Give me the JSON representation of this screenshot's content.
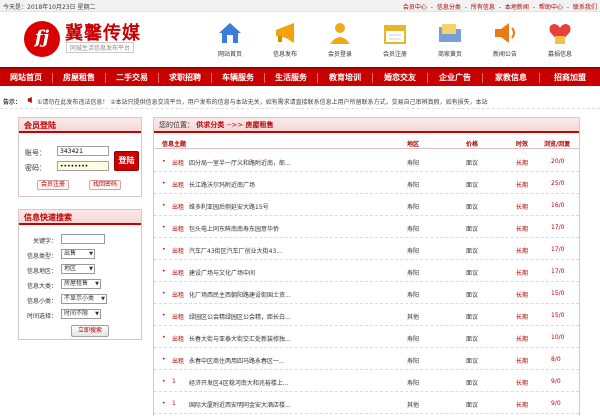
{
  "topbar": {
    "date": "今天是：2018年10月23日 星期二",
    "links": [
      "会员中心",
      "-",
      "信息分类",
      "-",
      "所有信息",
      "-",
      "本地新闻",
      "-",
      "帮助中心",
      "-",
      "联系我们"
    ]
  },
  "logo": {
    "mark": "fj",
    "title": "冀馨传媒",
    "subtitle": "同城生活信息发布平台"
  },
  "quick_links": [
    {
      "label": "网站首页",
      "icon": "house-icon",
      "color": "#3b7dd8"
    },
    {
      "label": "信息发布",
      "icon": "megaphone-icon",
      "color": "#f2a20c"
    },
    {
      "label": "会员登录",
      "icon": "person-icon",
      "color": "#f0a91a"
    },
    {
      "label": "会员注册",
      "icon": "calendar-icon",
      "color": "#e8b62c"
    },
    {
      "label": "商家黄页",
      "icon": "folder-icon",
      "color": "#7a9fd6"
    },
    {
      "label": "新闻公告",
      "icon": "speaker-icon",
      "color": "#e87a1a"
    },
    {
      "label": "募捐信息",
      "icon": "heart-icon",
      "color": "#e8403a"
    }
  ],
  "nav": {
    "items": [
      "网站首页",
      "房屋租售",
      "二手交易",
      "求职招聘",
      "车辆服务",
      "生活服务",
      "教育培训",
      "婚恋交友",
      "企业广告",
      "家教信息",
      "招商加盟"
    ]
  },
  "notice": {
    "label": "告示：",
    "text": "①请勿在此发布违法信息！ ②本站只提供信息交流平台，用户发布的信息与本站无关，如有需求请直接联系信息上用户所留联系方式，交易自己审辨真假，如有损失，本站"
  },
  "login": {
    "title": "会员登陆",
    "account_label": "账号：",
    "account_value": "343421",
    "password_label": "密码：",
    "password_value": "••••••••",
    "login_button": "登陆",
    "register_button": "会员注册",
    "forgot_button": "找回密码"
  },
  "search": {
    "title": "信息快速搜索",
    "fields": [
      {
        "label": "关键字：",
        "value": ""
      },
      {
        "label": "信息类型：",
        "value": "出售"
      },
      {
        "label": "信息地区：",
        "value": "地区"
      },
      {
        "label": "信息大类：",
        "value": "房屋租售"
      },
      {
        "label": "信息小类：",
        "value": "不显示小类"
      },
      {
        "label": "时间选择：",
        "value": "时间不限"
      }
    ],
    "submit": "立即搜索"
  },
  "list": {
    "breadcrumb_prefix": "您的位置：",
    "breadcrumb_mid": "供求分类",
    "breadcrumb_arrow": "-->>",
    "breadcrumb_current": "房屋租售",
    "columns": {
      "title": "信息主题",
      "area": "地区",
      "price": "价格",
      "time": "时效",
      "count": "浏览/回复"
    },
    "rows": [
      {
        "cat": "出租",
        "title": "四分局一室半一厅义和路附近南，郎...",
        "area": "寿阳",
        "price": "面议",
        "time": "长期",
        "count": "20/0"
      },
      {
        "cat": "出租",
        "title": "长江路沃尔玛附近南广场",
        "area": "寿阳",
        "price": "面议",
        "time": "长期",
        "count": "25/0"
      },
      {
        "cat": "出租",
        "title": "维多利亚园后侧延安大路15号",
        "area": "寿阳",
        "price": "面议",
        "time": "长期",
        "count": "16/0"
      },
      {
        "cat": "出租",
        "title": "包头电上同东眸南南寿东园意华侨",
        "area": "寿阳",
        "price": "面议",
        "time": "长期",
        "count": "17/0"
      },
      {
        "cat": "出租",
        "title": "汽车厂43街区汽车厂创业大街43...",
        "area": "寿阳",
        "price": "面议",
        "time": "长期",
        "count": "17/0"
      },
      {
        "cat": "出租",
        "title": "建设广场与文化广场中间",
        "area": "寿阳",
        "price": "面议",
        "time": "长期",
        "count": "17/0"
      },
      {
        "cat": "出租",
        "title": "化厂场西民主西朝阳路建设街国土资...",
        "area": "寿阳",
        "price": "面议",
        "time": "长期",
        "count": "15/0"
      },
      {
        "cat": "出租",
        "title": "绿园区公会精绿园区公会精，距长白...",
        "area": "其他",
        "price": "面议",
        "time": "长期",
        "count": "15/0"
      },
      {
        "cat": "出租",
        "title": "长春大街与亚泰大街交汇处新装修独...",
        "area": "寿阳",
        "price": "面议",
        "time": "长期",
        "count": "10/0"
      },
      {
        "cat": "出租",
        "title": "永春中区商住两用四马路永春区一...",
        "area": "寿阳",
        "price": "面议",
        "time": "长期",
        "count": "8/0"
      },
      {
        "cat": "1",
        "title": "经济开发区4区稳河南大和兆裕楼上...",
        "area": "寿阳",
        "price": "面议",
        "time": "长期",
        "count": "9/0"
      },
      {
        "cat": "1",
        "title": "国际大厦附近西安明同金安大酒店楼...",
        "area": "其他",
        "price": "面议",
        "time": "长期",
        "count": "9/0"
      }
    ]
  }
}
